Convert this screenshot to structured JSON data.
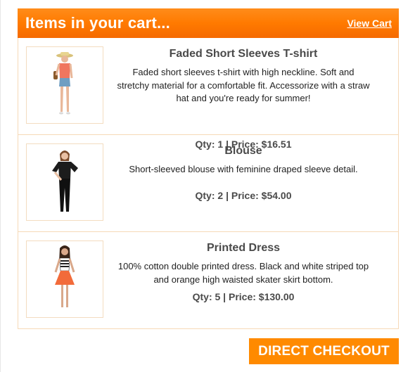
{
  "cart": {
    "title": "Items in your cart...",
    "view_cart_label": "View Cart",
    "items": [
      {
        "name": "Faded Short Sleeves T-shirt",
        "description": "Faded short sleeves t-shirt with high neckline. Soft and stretchy material for a comfortable fit. Accessorize with a straw hat and you're ready for summer!",
        "meta": "Qty: 1 | Price: $16.51"
      },
      {
        "name": "Blouse",
        "description": "Short-sleeved blouse with feminine draped sleeve detail.",
        "meta": "Qty: 2 | Price: $54.00"
      },
      {
        "name": "Printed Dress",
        "description": "100% cotton double printed dress. Black and white striped top and orange high waisted skater skirt bottom.",
        "meta": "Qty: 5 | Price: $130.00"
      }
    ]
  },
  "checkout_label": "DIRECT CHECKOUT",
  "colors": {
    "accent": "#ff8a00",
    "header_gradient_top": "#ff8c1a",
    "border": "#f6d9b7"
  },
  "icons": [
    "product-thumbnail-tshirt",
    "product-thumbnail-blouse",
    "product-thumbnail-dress"
  ]
}
